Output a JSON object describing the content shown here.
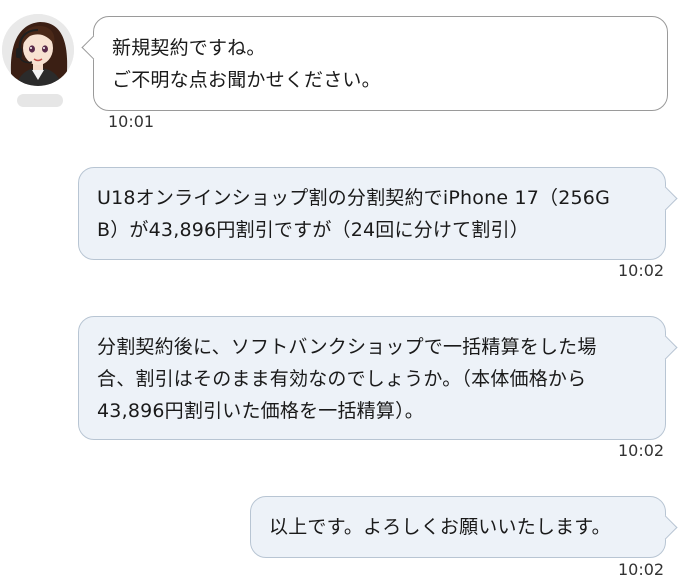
{
  "messages": [
    {
      "direction": "incoming",
      "lines": [
        "新規契約ですね。",
        "ご不明な点お聞かせください。"
      ],
      "time": "10:01"
    },
    {
      "direction": "outgoing",
      "lines": [
        "U18オンラインショップ割の分割契約でiPhone 17（256G",
        "B）が43,896円割引ですが（24回に分けて割引）"
      ],
      "time": "10:02"
    },
    {
      "direction": "outgoing",
      "lines": [
        "分割契約後に、ソフトバンクショップで一括精算をした場",
        "合、割引はそのまま有効なのでしょうか。（本体価格から",
        "43,896円割引いた価格を一括精算）。"
      ],
      "time": "10:02"
    },
    {
      "direction": "outgoing",
      "lines": [
        "以上です。よろしくお願いいたします。"
      ],
      "time": "10:02"
    }
  ],
  "colors": {
    "incoming_bg": "#ffffff",
    "incoming_border": "#9a9a9a",
    "outgoing_bg": "#edf2f8",
    "outgoing_border": "#b8c5d3"
  }
}
